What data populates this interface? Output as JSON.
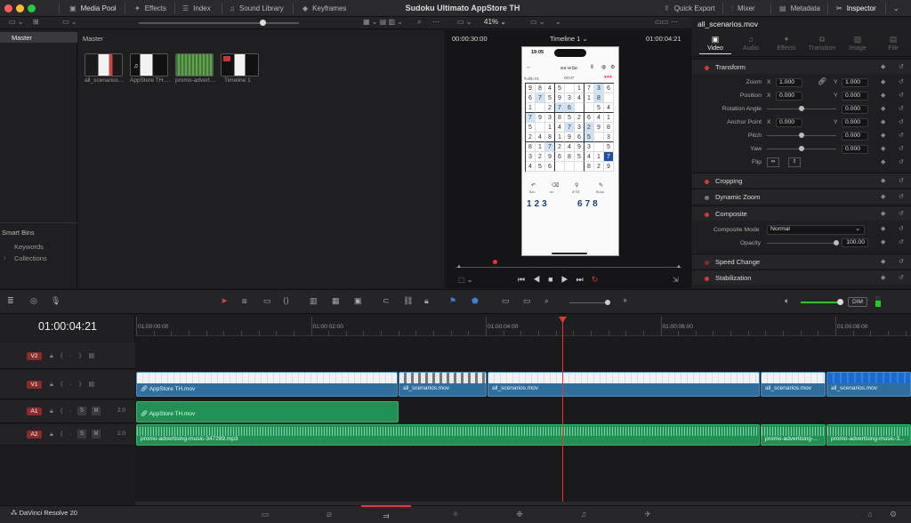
{
  "app": {
    "title": "Sudoku Ultimato AppStore TH",
    "product": "DaVinci Resolve 20"
  },
  "toolbar": {
    "media_pool": "Media Pool",
    "effects": "Effects",
    "index": "Index",
    "sound_library": "Sound Library",
    "keyframes": "Keyframes",
    "quick_export": "Quick Export",
    "mixer": "Mixer",
    "metadata": "Metadata",
    "inspector": "Inspector"
  },
  "viewer": {
    "zoom": "41%",
    "timeline_name": "Timeline 1",
    "source_tc": "00:00:30:00",
    "record_tc": "01:00:04:21"
  },
  "bins": {
    "master_left": "Master",
    "master_right": "Master",
    "smart_bins": "Smart Bins",
    "keywords": "Keywords",
    "collections": "Collections"
  },
  "media": [
    {
      "name": "all_scenarios.mov"
    },
    {
      "name": "AppStore TH.mov"
    },
    {
      "name": "promo-advertising-music.mp3"
    },
    {
      "name": "Timeline 1"
    }
  ],
  "inspector": {
    "clip_name": "all_scenarios.mov",
    "tabs": [
      "Video",
      "Audio",
      "Effects",
      "Transition",
      "Image",
      "File"
    ],
    "transform": {
      "title": "Transform",
      "zoom_label": "Zoom",
      "zoom_x": "1.000",
      "zoom_y": "1.000",
      "position_label": "Position",
      "pos_x": "0.000",
      "pos_y": "0.000",
      "rotation_label": "Rotation Angle",
      "rotation": "0.000",
      "anchor_label": "Anchor Point",
      "anchor_x": "0.000",
      "anchor_y": "0.000",
      "pitch_label": "Pitch",
      "pitch": "0.000",
      "yaw_label": "Yaw",
      "yaw": "0.000",
      "flip_label": "Flip",
      "x": "X",
      "y": "Y"
    },
    "cropping": "Cropping",
    "dynamic_zoom": "Dynamic Zoom",
    "composite": {
      "title": "Composite",
      "mode_label": "Composite Mode",
      "mode": "Normal",
      "opacity_label": "Opacity",
      "opacity": "100.00"
    },
    "speed_change": "Speed Change",
    "stabilization": "Stabilization"
  },
  "timeline": {
    "timecode": "01:00:04:21",
    "ruler": [
      "01:00:00:00",
      "01:00:02:00",
      "01:00:04:00",
      "01:00:06:00",
      "01:00:08:00"
    ],
    "dim": "DIM",
    "tracks": {
      "v2": "V2",
      "v1": "V1",
      "a1": "A1",
      "a2": "A2",
      "a1_level": "2.0",
      "a2_level": "2.0",
      "s": "S",
      "m": "M"
    },
    "clips": {
      "v1_1": "AppStore TH.mov",
      "v1_2": "all_scenarios.mov",
      "v1_3": "all_scenarios.mov",
      "v1_4": "all_scenarios.mov",
      "v1_5": "all_scenarios.mov",
      "a1_1": "AppStore TH.mov",
      "a2_1": "promo-advertising-music-347289.mp3",
      "a2_2": "promo-advertising-...",
      "a2_3": "promo-advertising-music-3..."
    }
  },
  "phone": {
    "time": "19:05",
    "screen_title": "ตลาดนัด",
    "level": "ระดับ #1",
    "timer": "00:07",
    "numpad": [
      "1",
      "2",
      "3",
      "6",
      "7",
      "8"
    ],
    "actions": [
      "ย้อน",
      "ลบ",
      "คำใบ้",
      "ดินสอ"
    ],
    "grid": [
      [
        "9",
        "8",
        "4",
        "5",
        "",
        "1",
        "7",
        "3",
        "6"
      ],
      [
        "6",
        "7",
        "5",
        "9",
        "3",
        "4",
        "1",
        "8",
        ""
      ],
      [
        "1",
        "",
        "2",
        "7",
        "6",
        "",
        "",
        "5",
        "4"
      ],
      [
        "7",
        "9",
        "3",
        "8",
        "5",
        "2",
        "6",
        "4",
        "1"
      ],
      [
        "5",
        "",
        "1",
        "4",
        "7",
        "3",
        "2",
        "9",
        "8"
      ],
      [
        "2",
        "4",
        "8",
        "1",
        "9",
        "6",
        "5",
        "",
        "3"
      ],
      [
        "8",
        "1",
        "7",
        "2",
        "4",
        "9",
        "3",
        "",
        "5"
      ],
      [
        "3",
        "2",
        "9",
        "6",
        "8",
        "5",
        "4",
        "1",
        "7"
      ],
      [
        "4",
        "5",
        "6",
        "",
        "",
        "",
        "8",
        "2",
        "9"
      ]
    ]
  }
}
